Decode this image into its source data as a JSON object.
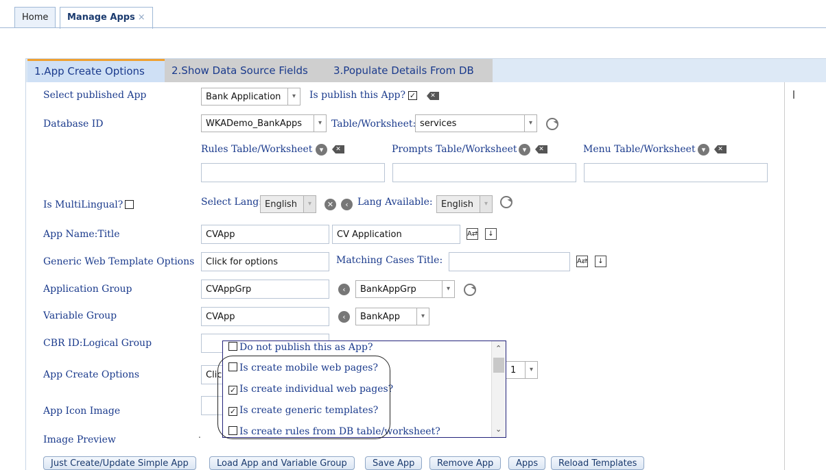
{
  "tabs": [
    {
      "label": "Home",
      "active": false
    },
    {
      "label": "Manage Apps",
      "active": true,
      "close": "×"
    }
  ],
  "steps": [
    {
      "label": "1.App Create Options"
    },
    {
      "label": "2.Show Data Source Fields"
    },
    {
      "label": "3.Populate Details From DB"
    }
  ],
  "form": {
    "select_published_app": {
      "label": "Select published App",
      "value": "Bank Application",
      "publish_label": "Is publish this App?",
      "publish_checked": true
    },
    "database_id": {
      "label": "Database ID",
      "value": "WKADemo_BankApps",
      "table_label": "Table/Worksheet:",
      "table_value": "services"
    },
    "rules_label": "Rules Table/Worksheet",
    "prompts_label": "Prompts Table/Worksheet",
    "menu_label": "Menu Table/Worksheet",
    "rules_value": "",
    "prompts_value": "",
    "menu_value": "",
    "multilingual": {
      "label": "Is MultiLingual?",
      "select_lang_label": "Select Lang:",
      "select_lang_value": "English",
      "lang_available_label": "Lang Available:",
      "lang_available_value": "English"
    },
    "app_name": {
      "label": "App Name:Title",
      "name": "CVApp",
      "title": "CV Application"
    },
    "generic_web": {
      "label": "Generic Web Template Options",
      "value": "Click for options",
      "matching_label": "Matching Cases Title:",
      "matching_value": ""
    },
    "application_group": {
      "label": "Application Group",
      "value": "CVAppGrp",
      "select_value": "BankAppGrp"
    },
    "variable_group": {
      "label": "Variable Group",
      "value": "CVApp",
      "select_value": "BankApp"
    },
    "cbr_id": {
      "label": "CBR ID:Logical Group",
      "value": ""
    },
    "app_create_options": {
      "label": "App Create Options",
      "value_fragment": "Clic",
      "select_fragment": "1"
    },
    "app_icon_image": {
      "label": "App Icon Image"
    },
    "image_preview": {
      "label": "Image Preview",
      "value": "."
    }
  },
  "dropdown_options": [
    {
      "label": "Do not publish this as App?",
      "checked": false
    },
    {
      "label": "Is create mobile web pages?",
      "checked": false
    },
    {
      "label": "Is create individual web pages?",
      "checked": true
    },
    {
      "label": "Is create generic templates?",
      "checked": true
    },
    {
      "label": "Is create rules from DB table/worksheet?",
      "checked": false
    }
  ],
  "buttons": [
    "Just Create/Update Simple App",
    "Load App and Variable Group",
    "Save App",
    "Remove App",
    "Apps",
    "Reload Templates"
  ],
  "glyphs": {
    "check": "☑",
    "empty": "☐",
    "down": "▾",
    "up": "▴",
    "down_arrow": "⌄"
  }
}
